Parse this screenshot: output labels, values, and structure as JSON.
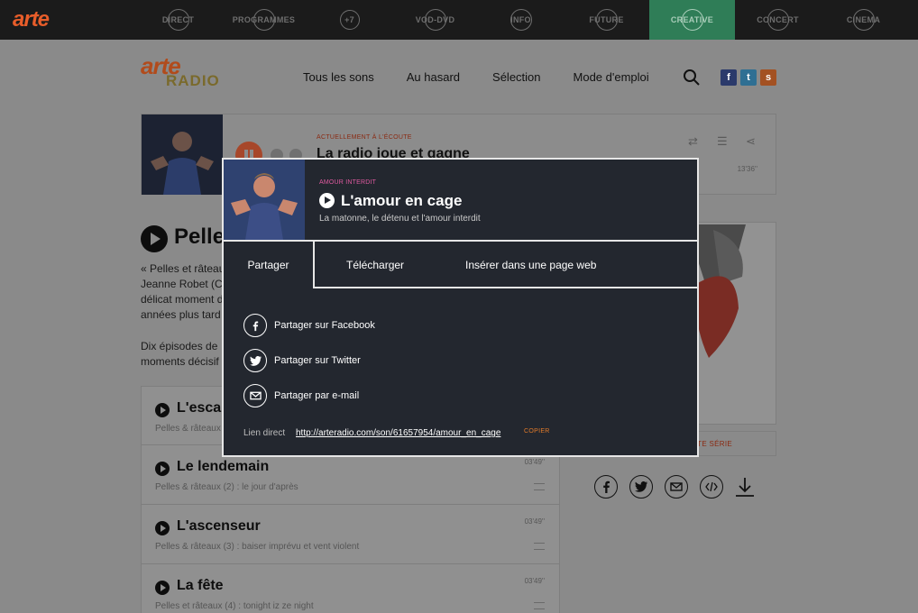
{
  "arte_bar": {
    "logo": "arte",
    "items": [
      {
        "label": "DIRECT"
      },
      {
        "label": "PROGRAMMES"
      },
      {
        "label": "+7"
      },
      {
        "label": "VOD-DVD"
      },
      {
        "label": "INFO"
      },
      {
        "label": "FUTURE"
      },
      {
        "label": "CREATIVE",
        "active": true
      },
      {
        "label": "CONCERT"
      },
      {
        "label": "CINEMA"
      }
    ]
  },
  "header": {
    "logo_main": "arte",
    "logo_sub": "RADIO",
    "nav": [
      "Tous les sons",
      "Au hasard",
      "Sélection",
      "Mode d'emploi"
    ],
    "social": [
      "f",
      "t",
      "s"
    ]
  },
  "player": {
    "kicker": "ACTUELLEMENT À L'ÉCOUTE",
    "title": "La radio joue et gagne",
    "time": "13'36''"
  },
  "main": {
    "heading": "Pelle",
    "desc_lines": [
      "« Pelles et râteau",
      "Jeanne Robet (C",
      "délicat moment d",
      "années plus tard"
    ],
    "desc2_lines": [
      "Dix épisodes de",
      "moments décisif"
    ]
  },
  "episodes": [
    {
      "title": "L'escal",
      "subtitle": "Pelles & râteaux",
      "duration": ""
    },
    {
      "title": "Le lendemain",
      "subtitle": "Pelles & râteaux (2) : le jour d'après",
      "duration": "03'49''"
    },
    {
      "title": "L'ascenseur",
      "subtitle": "Pelles & râteaux (3) : baiser imprévu et vent violent",
      "duration": "03'49''"
    },
    {
      "title": "La fête",
      "subtitle": "Pelles et râteaux (4) : tonight iz ze night",
      "duration": "03'49''"
    }
  ],
  "right": {
    "series_button": "TTE SÉRIE"
  },
  "modal": {
    "kicker": "AMOUR INTERDIT",
    "title": "L'amour en cage",
    "subtitle": "La matonne, le détenu et l'amour interdit",
    "tabs": {
      "share": "Partager",
      "download": "Télécharger",
      "embed": "Insérer dans une page web"
    },
    "options": {
      "facebook": "Partager sur Facebook",
      "twitter": "Partager sur Twitter",
      "email": "Partager par e-mail"
    },
    "link_label": "Lien direct",
    "link_url": "http://arteradio.com/son/61657954/amour_en_cage",
    "copy_label": "COPIER"
  },
  "colors": {
    "modal_bg": "#23272f",
    "accent_pink": "#e05aa0",
    "accent_orange": "#e07a2a",
    "arte_orange": "#e85d2a",
    "active_green": "#2f7d57"
  }
}
